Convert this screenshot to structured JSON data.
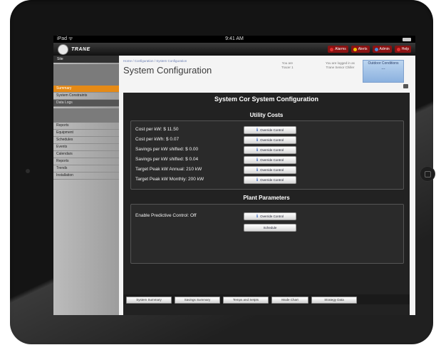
{
  "status_bar": {
    "carrier": "iPad ᯤ",
    "time": "9:41 AM"
  },
  "app": {
    "logo_text": "TRANE",
    "menu": [
      {
        "label": "Alarms",
        "color": "#e23030"
      },
      {
        "label": "Alerts",
        "color": "#f2c200"
      },
      {
        "label": "Admin",
        "color": "#4a8ad8"
      },
      {
        "label": "Help",
        "color": "#e23030"
      }
    ]
  },
  "sidebar": {
    "header": "Site",
    "items": [
      {
        "label": "Summary",
        "state": "active"
      },
      {
        "label": "System Constraints",
        "state": "normal"
      },
      {
        "label": "Data Logs",
        "state": "dark"
      },
      {
        "label": "Reports",
        "state": "normal"
      },
      {
        "label": "Equipment",
        "state": "normal"
      },
      {
        "label": "Schedules",
        "state": "normal"
      },
      {
        "label": "Events",
        "state": "normal"
      },
      {
        "label": "Calendars",
        "state": "normal"
      },
      {
        "label": "Reports",
        "state": "normal"
      },
      {
        "label": "Trends",
        "state": "normal"
      },
      {
        "label": "Installation",
        "state": "normal"
      }
    ]
  },
  "page": {
    "breadcrumb": "Home / Configuration / System Configuration",
    "title": "System Configuration",
    "site_label": "You are",
    "site_name": "Tracer 1",
    "login_label": "You are logged in as",
    "login_name": "Trane Senior Chiller",
    "outdoor_title": "Outdoor Conditions",
    "outdoor_value": "---"
  },
  "panel": {
    "title": "System Cor   System Configuration",
    "utility_heading": "Utility Costs",
    "utility_rows": [
      "Cost per kW: $  11.50",
      "Cost per kWh: $  0.07",
      "Savings per kW shifted: $  0.00",
      "Savings per kW shifted: $  0.04",
      "Target Peak kW Annual:  210 kW",
      "Target Peak kW Monthly:  200 kW"
    ],
    "plant_heading": "Plant Parameters",
    "plant_rows": [
      "Enable Predictive Control:  Off"
    ],
    "override_label": "Override Control",
    "schedule_label": "Schedule",
    "footer_buttons": [
      "System Summary",
      "Savings Summary",
      "Temps and Setpts",
      "Mode Chart",
      "Strategy Data"
    ]
  }
}
